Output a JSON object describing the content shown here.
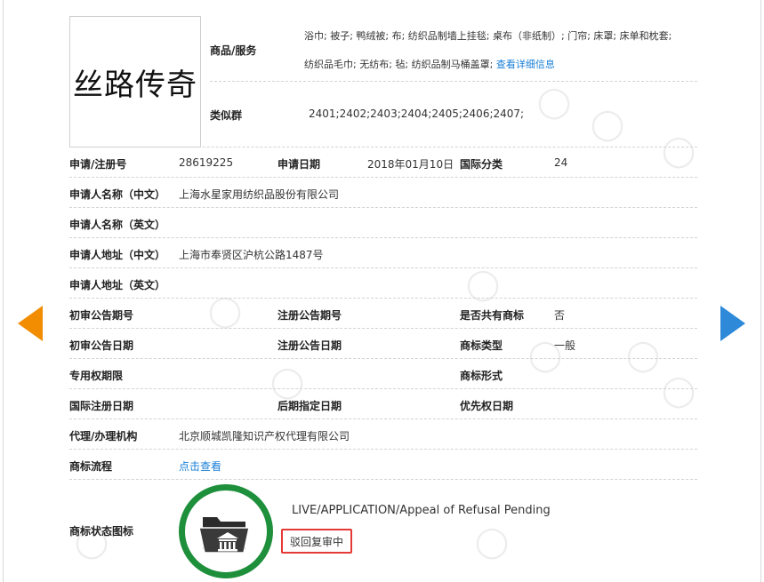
{
  "logo_text": "丝路传奇",
  "goods": {
    "label": "商品/服务",
    "line1": "浴巾; 被子; 鸭绒被; 布; 纺织品制墙上挂毯; 桌布（非纸制）; 门帘; 床罩; 床单和枕套;",
    "line2": "纺织品毛巾; 无纺布; 毡; 纺织品制马桶盖罩;",
    "detail_link": "查看详细信息"
  },
  "similar_group": {
    "label": "类似群",
    "value": "2401;2402;2403;2404;2405;2406;2407;"
  },
  "rows": {
    "reg_no_label": "申请/注册号",
    "reg_no": "28619225",
    "apply_date_label": "申请日期",
    "apply_date": "2018年01月10日",
    "intl_class_label": "国际分类",
    "intl_class": "24",
    "applicant_cn_label": "申请人名称（中文）",
    "applicant_cn": "上海水星家用纺织品股份有限公司",
    "applicant_en_label": "申请人名称（英文）",
    "applicant_en": "",
    "address_cn_label": "申请人地址（中文）",
    "address_cn": "上海市奉贤区沪杭公路1487号",
    "address_en_label": "申请人地址（英文）",
    "address_en": "",
    "prelim_no_label": "初审公告期号",
    "prelim_no": "",
    "reg_notice_no_label": "注册公告期号",
    "reg_notice_no": "",
    "shared_label": "是否共有商标",
    "shared": "否",
    "prelim_date_label": "初审公告日期",
    "prelim_date": "",
    "reg_notice_date_label": "注册公告日期",
    "reg_notice_date": "",
    "tm_type_label": "商标类型",
    "tm_type": "一般",
    "exclusive_period_label": "专用权期限",
    "exclusive_period": "",
    "tm_form_label": "商标形式",
    "tm_form": "",
    "intl_reg_date_label": "国际注册日期",
    "intl_reg_date": "",
    "later_date_label": "后期指定日期",
    "later_date": "",
    "priority_date_label": "优先权日期",
    "priority_date": "",
    "agent_label": "代理/办理机构",
    "agent": "北京顺城凯隆知识产权代理有限公司",
    "process_label": "商标流程",
    "process_link": "点击查看"
  },
  "status": {
    "label": "商标状态图标",
    "en": "LIVE/APPLICATION/Appeal of Refusal Pending",
    "cn": "驳回复审中",
    "icon": "folder-courthouse-icon",
    "ring_color": "#1e8f3b"
  },
  "nav": {
    "prev_icon": "arrow-left-icon",
    "next_icon": "arrow-right-icon",
    "prev_color": "#f28c00",
    "next_color": "#2e8ad8"
  }
}
